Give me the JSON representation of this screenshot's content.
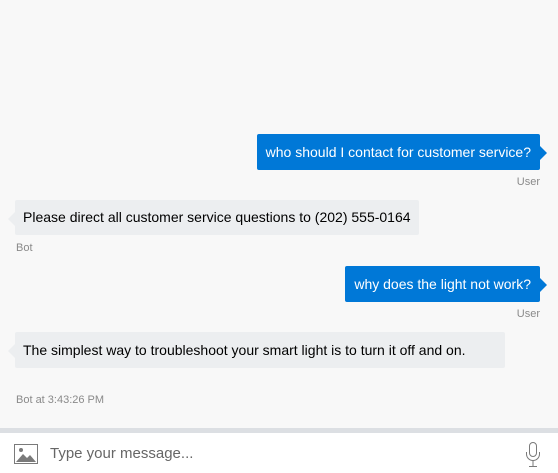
{
  "messages": [
    {
      "from": "user",
      "text": "who should I contact for customer service?",
      "meta": "User"
    },
    {
      "from": "bot",
      "text": "Please direct all customer service questions to (202) 555-0164",
      "meta": "Bot"
    },
    {
      "from": "user",
      "text": "why does the light not work?",
      "meta": "User"
    },
    {
      "from": "bot",
      "text": "The simplest way to troubleshoot your smart light is to turn it off and on.",
      "meta": "Bot at 3:43:26 PM"
    }
  ],
  "composer": {
    "placeholder": "Type your message...",
    "upload_icon": "image-icon",
    "mic_icon": "microphone-icon"
  },
  "colors": {
    "user_bubble": "#0078d7",
    "bot_bubble": "#eceef0",
    "background": "#f8f8f8"
  }
}
